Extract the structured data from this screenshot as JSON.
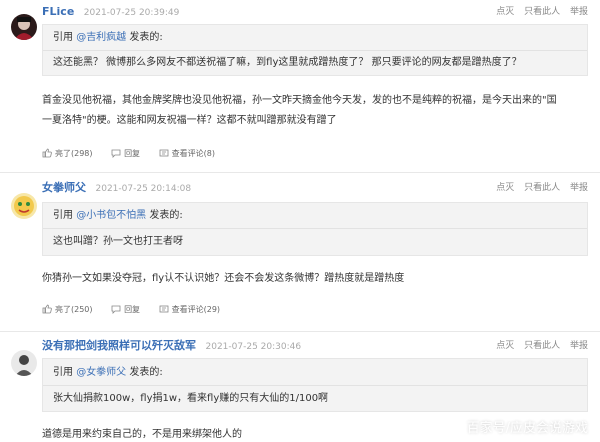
{
  "comments": [
    {
      "user": "FLice",
      "time": "2021-07-25 20:39:49",
      "ops": [
        "点灭",
        "只看此人",
        "举报"
      ],
      "quote_prefix": "引用",
      "quote_user": "@吉利疯越",
      "quote_suffix": "发表的:",
      "quote_text": "这还能黑？ 微博那么多网友不都送祝福了嘛，到fly这里就成蹭热度了？ 那只要评论的网友都是蹭热度了？",
      "text": "首金没见他祝福，其他金牌奖牌也没见他祝福，孙一文昨天摘金他今天发，发的也不是纯粹的祝福，是今天出来的\"国一夏洛特\"的梗。这能和网友祝福一样？这都不就叫蹭那就没有蹭了",
      "actions": [
        "亮了(298)",
        "回复",
        "查看评论(8)"
      ]
    },
    {
      "user": "女拳师父",
      "time": "2021-07-25 20:14:08",
      "ops": [
        "点灭",
        "只看此人",
        "举报"
      ],
      "quote_prefix": "引用",
      "quote_user": "@小书包不怕黑",
      "quote_suffix": "发表的:",
      "quote_text": "这也叫蹭？孙一文也打王者呀",
      "text": "你猜孙一文如果没夺冠，fly认不认识她？还会不会发这条微博？蹭热度就是蹭热度",
      "actions": [
        "亮了(250)",
        "回复",
        "查看评论(29)"
      ]
    },
    {
      "user": "没有那把剑我照样可以歼灭敌军",
      "time": "2021-07-25 20:30:46",
      "ops": [
        "点灭",
        "只看此人",
        "举报"
      ],
      "quote_prefix": "引用",
      "quote_user": "@女拳师父",
      "quote_suffix": "发表的:",
      "quote_text": "张大仙捐款100w，fly捐1w，看来fly赚的只有大仙的1/100啊",
      "text": "道德是用来约束自己的，不是用来绑架他人的",
      "actions": []
    }
  ],
  "watermark": "百家号/应皮会说游戏",
  "colors": {
    "link": "#3b6fb6",
    "quote_bg": "#f3f3f3",
    "muted": "#aaaaaa"
  },
  "icons": {
    "like": "thumbs-up-icon",
    "reply": "reply-icon",
    "view": "comments-icon"
  }
}
